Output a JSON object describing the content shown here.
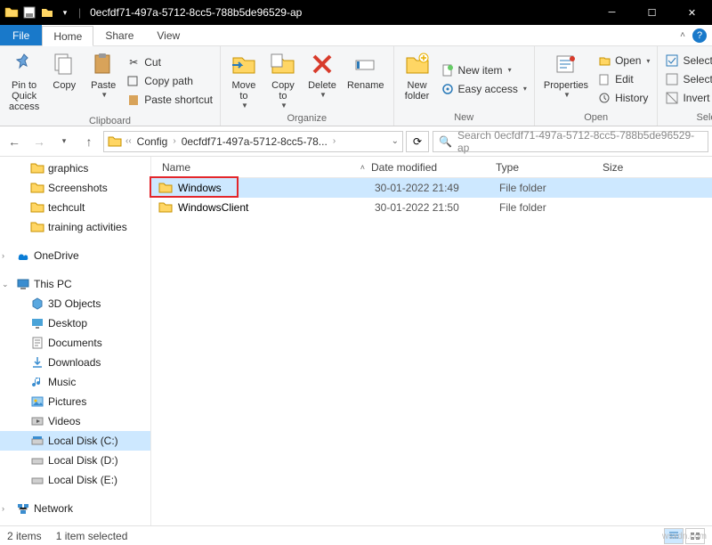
{
  "window": {
    "title": "0ecfdf71-497a-5712-8cc5-788b5de96529-ap"
  },
  "menubar": {
    "file": "File",
    "tabs": [
      "Home",
      "Share",
      "View"
    ]
  },
  "ribbon": {
    "clipboard": {
      "label": "Clipboard",
      "pin": "Pin to Quick\naccess",
      "copy": "Copy",
      "paste": "Paste",
      "cut": "Cut",
      "copy_path": "Copy path",
      "paste_shortcut": "Paste shortcut"
    },
    "organize": {
      "label": "Organize",
      "move": "Move\nto",
      "copy": "Copy\nto",
      "delete": "Delete",
      "rename": "Rename"
    },
    "new": {
      "label": "New",
      "folder": "New\nfolder",
      "item": "New item",
      "easy": "Easy access"
    },
    "open": {
      "label": "Open",
      "props": "Properties",
      "open": "Open",
      "edit": "Edit",
      "history": "History"
    },
    "select": {
      "label": "Select",
      "all": "Select all",
      "none": "Select none",
      "invert": "Invert selection"
    }
  },
  "nav": {
    "crumbs": [
      "Config",
      "0ecfdf71-497a-5712-8cc5-78..."
    ],
    "search_placeholder": "Search 0ecfdf71-497a-5712-8cc5-788b5de96529-ap"
  },
  "columns": {
    "name": "Name",
    "date": "Date modified",
    "type": "Type",
    "size": "Size"
  },
  "rows": [
    {
      "name": "Windows",
      "date": "30-01-2022 21:49",
      "type": "File folder",
      "selected": true
    },
    {
      "name": "WindowsClient",
      "date": "30-01-2022 21:50",
      "type": "File folder",
      "selected": false
    }
  ],
  "tree": {
    "quick": [
      "graphics",
      "Screenshots",
      "techcult",
      "training activities"
    ],
    "onedrive": "OneDrive",
    "thispc": "This PC",
    "pc_items": [
      "3D Objects",
      "Desktop",
      "Documents",
      "Downloads",
      "Music",
      "Pictures",
      "Videos",
      "Local Disk (C:)",
      "Local Disk (D:)",
      "Local Disk (E:)"
    ],
    "network": "Network"
  },
  "status": {
    "items": "2 items",
    "selected": "1 item selected"
  },
  "watermark": "wsxdn.com"
}
